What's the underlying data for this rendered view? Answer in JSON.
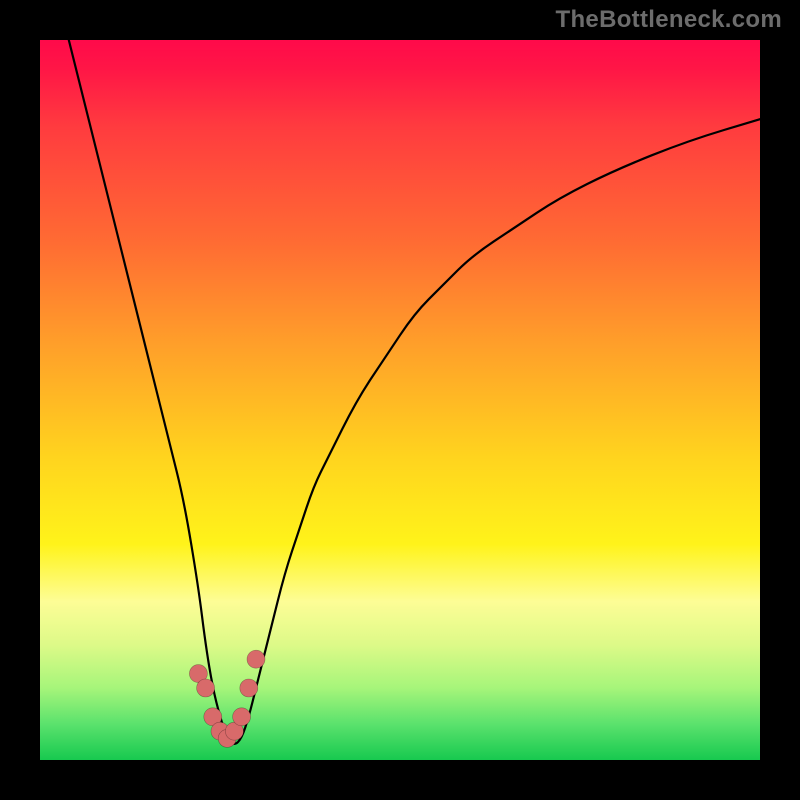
{
  "watermark": "TheBottleneck.com",
  "chart_data": {
    "type": "line",
    "title": "",
    "xlabel": "",
    "ylabel": "",
    "xlim": [
      0,
      100
    ],
    "ylim": [
      0,
      100
    ],
    "x": [
      4,
      6,
      8,
      10,
      12,
      14,
      16,
      18,
      20,
      22,
      23,
      24,
      25,
      26,
      27,
      28,
      29,
      30,
      32,
      34,
      36,
      38,
      40,
      44,
      48,
      52,
      56,
      60,
      66,
      72,
      80,
      90,
      100
    ],
    "y": [
      100,
      92,
      84,
      76,
      68,
      60,
      52,
      44,
      36,
      24,
      16,
      10,
      6,
      3,
      2,
      3,
      6,
      10,
      18,
      26,
      32,
      38,
      42,
      50,
      56,
      62,
      66,
      70,
      74,
      78,
      82,
      86,
      89
    ],
    "markers_x": [
      22,
      23,
      24,
      25,
      26,
      27,
      28,
      29,
      30
    ],
    "markers_y": [
      12,
      10,
      6,
      4,
      3,
      4,
      6,
      10,
      14
    ],
    "gradient_stops": [
      {
        "t": 0.0,
        "color": "#ff0a4a"
      },
      {
        "t": 0.28,
        "color": "#ff6b33"
      },
      {
        "t": 0.58,
        "color": "#ffd41e"
      },
      {
        "t": 0.8,
        "color": "#fdfd96"
      },
      {
        "t": 1.0,
        "color": "#17c94f"
      }
    ]
  }
}
